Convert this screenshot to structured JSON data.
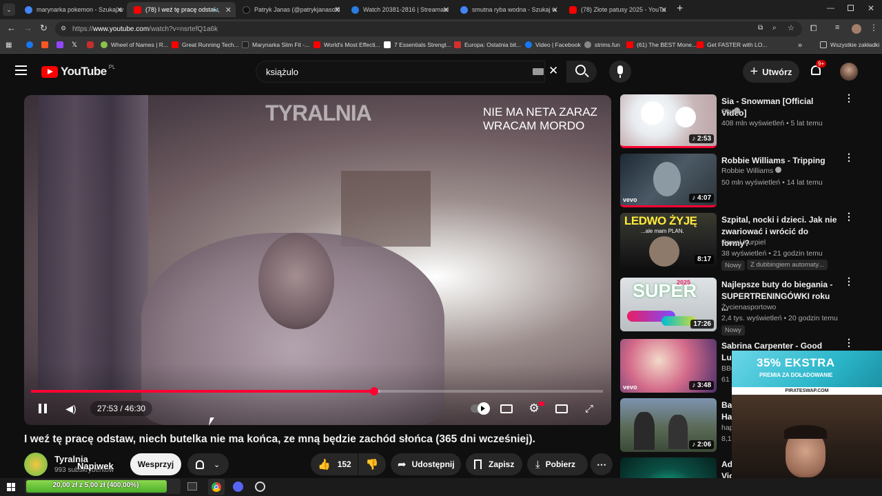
{
  "browser": {
    "tabs": [
      {
        "label": "marynarka pokemon - Szukaj w",
        "color": "#4285f4",
        "active": false
      },
      {
        "label": "(78) I weź tę pracę odstaw,",
        "color": "#ff0000",
        "active": true
      },
      {
        "label": "Patryk Janas (@patrykjanasoffi",
        "color": "#111111",
        "active": false
      },
      {
        "label": "Watch 20381-2816 | Streamabl",
        "color": "#2a7cdf",
        "active": false
      },
      {
        "label": "smutna ryba wodna - Szukaj w",
        "color": "#4285f4",
        "active": false
      },
      {
        "label": "(78) Złote patusy 2025 - YouTu",
        "color": "#ff0000",
        "active": false
      }
    ],
    "new_tab": "+",
    "url_prefix": "https://",
    "url_host": "www.youtube.com",
    "url_path": "/watch?v=nsrtefQ1a6k",
    "bookmarks": [
      {
        "label": "",
        "color": "#1877f2"
      },
      {
        "label": "",
        "color": "#ff5722"
      },
      {
        "label": "",
        "color": "#9146ff"
      },
      {
        "label": "",
        "color": "#000000"
      },
      {
        "label": "",
        "color": "#c4302b"
      },
      {
        "label": "Wheel of Names | R...",
        "color": "#8bc34a"
      },
      {
        "label": "Great Running Tech...",
        "color": "#ff0000"
      },
      {
        "label": "Marynarka Slim Fit -...",
        "color": "#222222"
      },
      {
        "label": "World's Most Effecti...",
        "color": "#ff0000"
      },
      {
        "label": "7 Essentials Strengt...",
        "color": "#ffffff"
      },
      {
        "label": "Europa: Ostatnia bit...",
        "color": "#d32f2f"
      },
      {
        "label": "Video | Facebook",
        "color": "#1877f2"
      },
      {
        "label": "strims.fun",
        "color": "#888888"
      },
      {
        "label": "(61) The BEST Mone...",
        "color": "#ff0000"
      },
      {
        "label": "Get FASTER with LO...",
        "color": "#ff0000"
      }
    ],
    "all_bookmarks": "Wszystkie zakładki"
  },
  "youtube": {
    "logo": "YouTube",
    "region": "PL",
    "search_value": "książulo",
    "create_label": "Utwórz",
    "notif_count": "9+",
    "player": {
      "watermark": "TYRALNIA",
      "overlay_line1": "NIE MA NETA ZARAZ",
      "overlay_line2": "WRACAM MORDO",
      "time": "27:53 / 46:30",
      "progress_fraction": 0.5997,
      "buffer_fraction": 0.61
    },
    "video_title": "I weź tę pracę odstaw, niech butelka nie ma końca, ze mną będzie zachód słońca (365 dni wcześniej).",
    "channel": {
      "name": "Tyralnia",
      "subs": "993 subskrybentów",
      "overlay": "Napiwek"
    },
    "actions": {
      "support": "Wesprzyj",
      "likes": "152",
      "share": "Udostępnij",
      "save": "Zapisz",
      "download": "Pobierz"
    },
    "recommendations": [
      {
        "title": "Sia - Snowman [Official Video]",
        "channel": "Sia",
        "meta": "408 mln wyświetleń • 5 lat temu",
        "duration": "2:53",
        "verified": true,
        "badge": "",
        "badge2": ""
      },
      {
        "title": "Robbie Williams - Tripping",
        "channel": "Robbie Williams",
        "meta": "50 mln wyświetleń • 14 lat temu",
        "duration": "4:07",
        "verified": true,
        "badge": "",
        "badge2": ""
      },
      {
        "title": "Szpital, nocki i dzieci. Jak nie zwariować i wrócić do formy?",
        "channel": "Paweł Kurpiel",
        "meta": "38 wyświetleń • 21 godzin temu",
        "duration": "8:17",
        "verified": false,
        "badge": "Nowy",
        "badge2": "Z dubbingiem automaty..."
      },
      {
        "title": "Najlepsze buty do biegania - SUPERTRENINGÓWKI roku ...",
        "channel": "Życienasportowo",
        "meta": "2,4 tys. wyświetleń • 20 godzin temu",
        "duration": "17:26",
        "verified": false,
        "badge": "Nowy",
        "badge2": ""
      },
      {
        "title": "Sabrina Carpenter - Good Luck, Ba",
        "channel": "BBC",
        "meta": "61",
        "duration": "3:48",
        "verified": false,
        "badge": "",
        "badge2": ""
      },
      {
        "title": "Ba Ha",
        "channel": "hap",
        "meta": "8,1",
        "duration": "2:06",
        "verified": false,
        "badge": "",
        "badge2": ""
      },
      {
        "title": "Ad Vid",
        "channel": "",
        "meta": "",
        "duration": "",
        "verified": false,
        "badge": "",
        "badge2": ""
      }
    ],
    "thumb_texts": {
      "ledwo": "LEDWO ŻYJĘ",
      "ledwo_sub": "...ale mam PLAN.",
      "super": "SUPER",
      "super_year": "2025",
      "vevo": "vevo"
    }
  },
  "overlay_ad": {
    "line1": "35% EKSTRA",
    "line2": "PREMIA ZA DOŁADOWANIE",
    "site": "PIRATESWAP.COM"
  },
  "tip_bar": {
    "text": "20,00 zł z 5,00 zł (400,00%)"
  }
}
